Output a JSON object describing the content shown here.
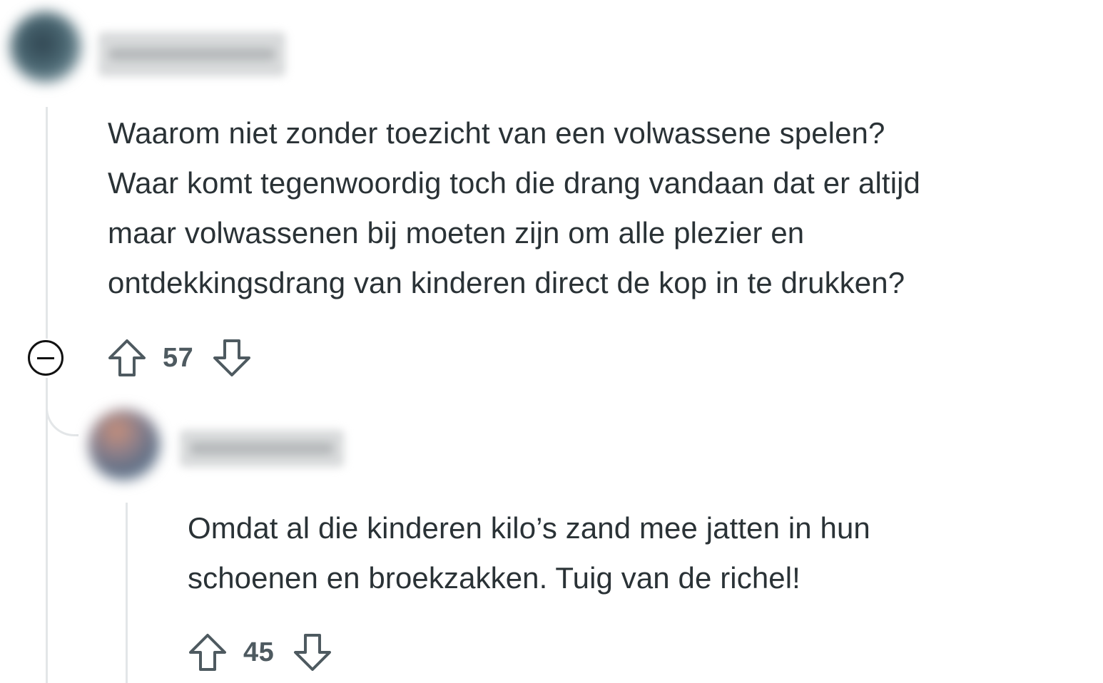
{
  "comments": [
    {
      "text_lines": [
        "Waarom niet zonder toezicht van een volwassene spelen?",
        "Waar komt tegenwoordig toch die drang vandaan dat er altijd",
        "maar volwassenen bij moeten zijn om alle plezier en",
        "ontdekkingsdrang van kinderen direct de kop in te drukken?"
      ],
      "score": "57",
      "avatar_colors": [
        "#3f5663",
        "#6b8a96"
      ],
      "icons": {
        "upvote": "upvote-arrow-icon",
        "downvote": "downvote-arrow-icon",
        "collapse": "collapse-minus-icon"
      }
    },
    {
      "text_lines": [
        "Omdat al die kinderen kilo’s zand mee jatten in hun",
        "schoenen en broekzakken. Tuig van de richel!"
      ],
      "score": "45",
      "avatar_colors": [
        "#6f7f94",
        "#c09a86"
      ],
      "icons": {
        "upvote": "upvote-arrow-icon",
        "downvote": "downvote-arrow-icon"
      }
    }
  ],
  "colors": {
    "text": "#2a3236",
    "score": "#4e5a60",
    "thread_line": "#e3e6e8"
  }
}
